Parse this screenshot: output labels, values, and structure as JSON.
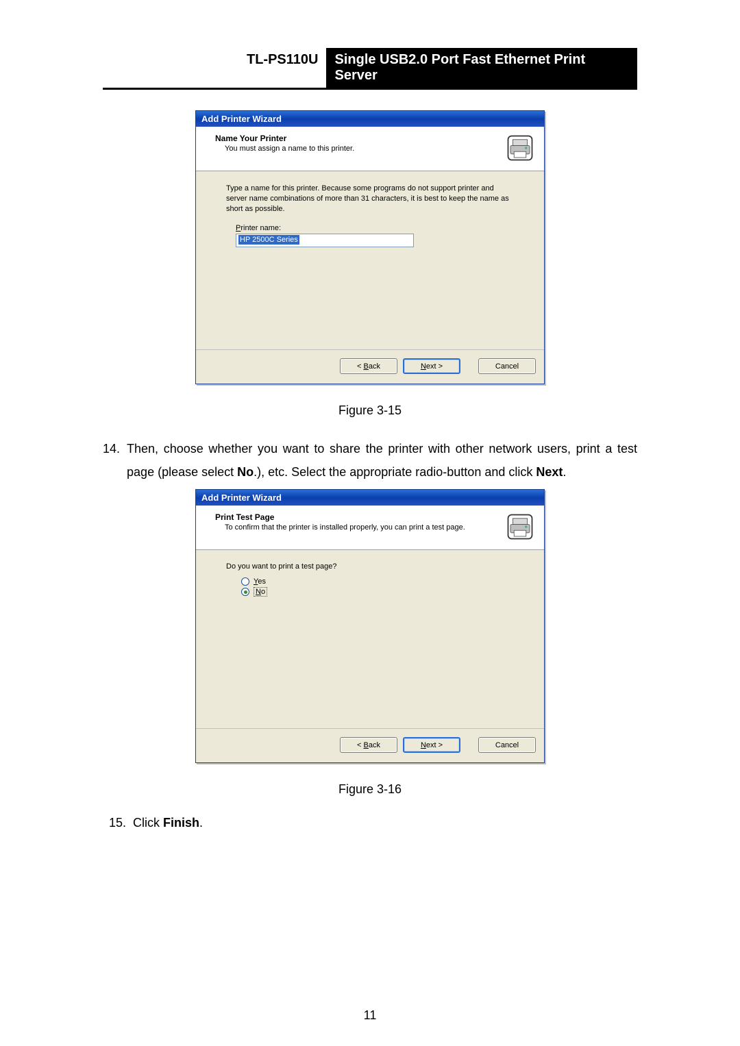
{
  "header": {
    "model": "TL-PS110U",
    "title": "Single USB2.0 Port Fast Ethernet Print Server"
  },
  "wizard1": {
    "bar": "Add Printer Wizard",
    "heading": "Name Your Printer",
    "sub": "You must assign a name to this printer.",
    "desc": "Type a name for this printer. Because some programs do not support printer and server name combinations of more than 31 characters, it is best to keep the name as short as possible.",
    "field_label_pre": "P",
    "field_label_post": "rinter name:",
    "field_value": "HP 2500C Series",
    "back_pre": "< ",
    "back_u": "B",
    "back_post": "ack",
    "next_u": "N",
    "next_post": "ext >",
    "cancel": "Cancel"
  },
  "caption1": "Figure 3-15",
  "step14": {
    "num": "14.",
    "t1": "Then, choose whether you want to share the printer with other network users, print a test page (please select ",
    "no": "No",
    "t2": ".), etc. Select the appropriate radio-button and click ",
    "next": "Next",
    "t3": "."
  },
  "wizard2": {
    "bar": "Add Printer Wizard",
    "heading": "Print Test Page",
    "sub": "To confirm that the printer is installed properly, you can print a test page.",
    "question": "Do you want to print a test page?",
    "yes_u": "Y",
    "yes_post": "es",
    "no_u": "N",
    "no_post": "o",
    "back_pre": "< ",
    "back_u": "B",
    "back_post": "ack",
    "next_u": "N",
    "next_post": "ext >",
    "cancel": "Cancel"
  },
  "caption2": "Figure 3-16",
  "step15": {
    "num": "15.",
    "t1": "Click ",
    "finish": "Finish",
    "t2": "."
  },
  "page_number": "11"
}
